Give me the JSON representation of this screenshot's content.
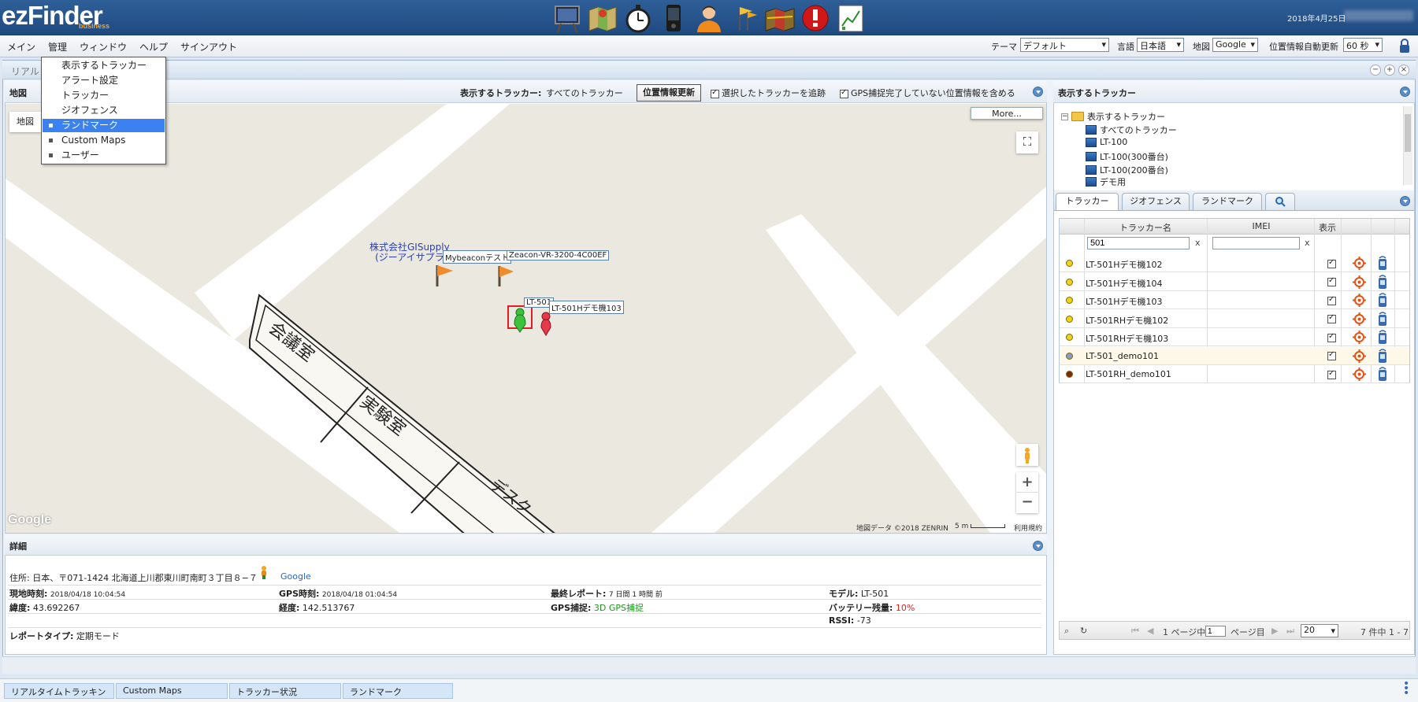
{
  "header": {
    "logo_main": "ezFinder",
    "logo_sub": "business",
    "date": "2018年4月25日",
    "toolbar_icons": [
      "monitor-board-icon",
      "map-icon",
      "stopwatch-icon",
      "device-icon",
      "user-icon",
      "flags-icon",
      "map-layers-icon",
      "alert-icon",
      "chart-report-icon"
    ]
  },
  "menubar": {
    "items": [
      "メイン",
      "管理",
      "ウィンドウ",
      "ヘルプ",
      "サインアウト"
    ],
    "theme_label": "テーマ",
    "theme_value": "デフォルト",
    "language_label": "言語",
    "language_value": "日本語",
    "map_label": "地図",
    "map_value": "Google",
    "auto_update_label": "位置情報自動更新",
    "auto_update_value": "60 秒"
  },
  "dropdown": {
    "items": [
      "表示するトラッカー",
      "アラート設定",
      "トラッカー",
      "ジオフェンス",
      "ランドマーク",
      "Custom Maps",
      "ユーザー"
    ],
    "active_index": 4
  },
  "window": {
    "title": "リアルタイムトラッキング",
    "title_visible": "リアル"
  },
  "map_panel": {
    "title": "地図",
    "tracker_label": "表示するトラッカー:",
    "tracker_value": "すべてのトラッカー",
    "refresh_button": "位置情報更新",
    "follow_label": "選択したトラッカーを追跡",
    "gps_label": "GPS捕捉完了していない位置情報を含める",
    "map_type_button": "地図",
    "more_button": "More...",
    "rooms": [
      "会議室",
      "実験室",
      "デスク"
    ],
    "landmark_name_line1": "株式会社GISupply",
    "landmark_name_line2": "(ジーアイサプラ",
    "label_mybeacon": "Mybeaconテスト",
    "label_zeacon": "Zeacon-VR-3200-4C00EF",
    "label_lt501_partial": "LT-501",
    "label_lt501_demo": "LT-501Hデモ機103",
    "google_logo": "Google",
    "map_credit": "地図データ ©2018 ZENRIN",
    "scale": "5 m",
    "terms": "利用規約"
  },
  "detail": {
    "title": "詳細",
    "address_label": "住所:",
    "address_value": "日本、〒071-1424 北海道上川郡東川町南町３丁目８−７",
    "google_link": "Google",
    "local_time_label": "現地時刻:",
    "local_time_value": "2018/04/18 10:04:54",
    "gps_time_label": "GPS時刻:",
    "gps_time_value": "2018/04/18 01:04:54",
    "last_report_label": "最終レポート:",
    "last_report_value": "7 日間 1 時間 前",
    "model_label": "モデル:",
    "model_value": "LT-501",
    "lat_label": "緯度:",
    "lat_value": "43.692267",
    "lng_label": "経度:",
    "lng_value": "142.513767",
    "gps_fix_label": "GPS捕捉:",
    "gps_fix_value": "3D GPS捕捉",
    "battery_label": "バッテリー残量:",
    "battery_value": "10%",
    "rssi_label": "RSSI:",
    "rssi_value": "-73",
    "report_type_label": "レポートタイプ:",
    "report_type_value": "定期モード"
  },
  "right_panel": {
    "title": "表示するトラッカー",
    "tree_root": "表示するトラッカー",
    "tree_items": [
      "すべてのトラッカー",
      "LT-100",
      "LT-100(300番台)",
      "LT-100(200番台)",
      "デモ用"
    ],
    "tabs": [
      "トラッカー",
      "ジオフェンス",
      "ランドマーク"
    ],
    "col_name": "トラッカー名",
    "col_imei": "IMEI",
    "col_show": "表示",
    "filter_name": "501",
    "filter_imei": "",
    "rows": [
      {
        "name": "LT-501Hデモ機102",
        "dot": "#f2d21a"
      },
      {
        "name": "LT-501Hデモ機104",
        "dot": "#f2d21a"
      },
      {
        "name": "LT-501Hデモ機103",
        "dot": "#f2d21a"
      },
      {
        "name": "LT-501RHデモ機102",
        "dot": "#f2d21a"
      },
      {
        "name": "LT-501RHデモ機103",
        "dot": "#f2d21a"
      },
      {
        "name": "LT-501_demo101",
        "dot": "#8a9bc9"
      },
      {
        "name": "LT-501RH_demo101",
        "dot": "#7a2a10"
      }
    ],
    "pager": {
      "page_of": "1 ページ中",
      "page_value": "1",
      "page_suffix": "ページ目",
      "per_page": "20",
      "count": "7 件中 1 - 7"
    }
  },
  "taskbar": {
    "items": [
      "リアルタイムトラッキン",
      "Custom Maps",
      "トラッカー状況",
      "ランドマーク"
    ]
  }
}
